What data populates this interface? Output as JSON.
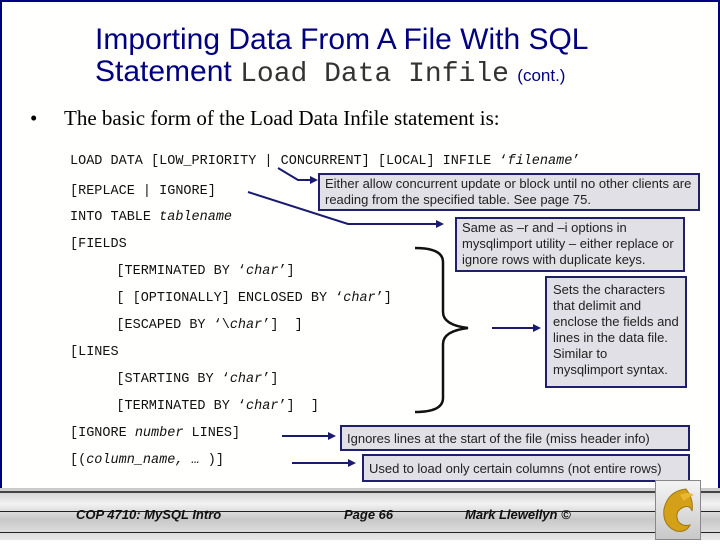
{
  "title": {
    "line1": "Importing Data From A File With SQL",
    "line2_prefix": "Statement",
    "line2_code": "Load Data Infile",
    "line2_suffix": "(cont.)"
  },
  "bullet": {
    "symbol": "•",
    "text": "The basic form of the Load Data Infile statement is:"
  },
  "code": {
    "l1_a": "LOAD DATA [LOW_PRIORITY | CONCURRENT] [LOCAL] INFILE ‘",
    "l1_b": "filename",
    "l1_c": "’",
    "l2": "[REPLACE | IGNORE]",
    "l3_a": "INTO TABLE ",
    "l3_b": "tablename",
    "l4": "[FIELDS",
    "l5_a": "    [TERMINATED BY ‘",
    "l5_b": "char",
    "l5_c": "’]",
    "l6_a": "    [ [OPTIONALLY] ENCLOSED BY ‘",
    "l6_b": "char",
    "l6_c": "’]",
    "l7_a": "    [ESCAPED BY ‘\\",
    "l7_b": "char",
    "l7_c": "’]  ]",
    "l8": "[LINES",
    "l9_a": "    [STARTING BY ‘",
    "l9_b": "char",
    "l9_c": "’]",
    "l10_a": "    [TERMINATED BY ‘",
    "l10_b": "char",
    "l10_c": "’]  ]",
    "l11_a": "[IGNORE ",
    "l11_b": "number",
    "l11_c": " LINES]",
    "l12_a": "[(",
    "l12_b": "column_name, …",
    "l12_c": " )]"
  },
  "notes": {
    "concurrent": "Either allow concurrent update or block until no other clients are reading from the specified table.  See page 75.",
    "replace": "Same as –r and –i options in mysqlimport utility – either replace or ignore rows with duplicate keys.",
    "fields": "Sets the characters that delimit and enclose the fields and lines in the data file.  Similar to mysqlimport syntax.",
    "ignore": "Ignores lines at the start of the file (miss header info)",
    "columns": "Used to load only certain columns (not entire rows)"
  },
  "footer": {
    "course": "COP 4710: MySQL Intro",
    "page": "Page 66",
    "author": "Mark Llewellyn ©"
  },
  "colors": {
    "title": "#000080",
    "frame": "#000080",
    "note_bg": "#e0e0e6",
    "arrow": "#1a1a6e",
    "logo_gold": "#d4a017"
  }
}
